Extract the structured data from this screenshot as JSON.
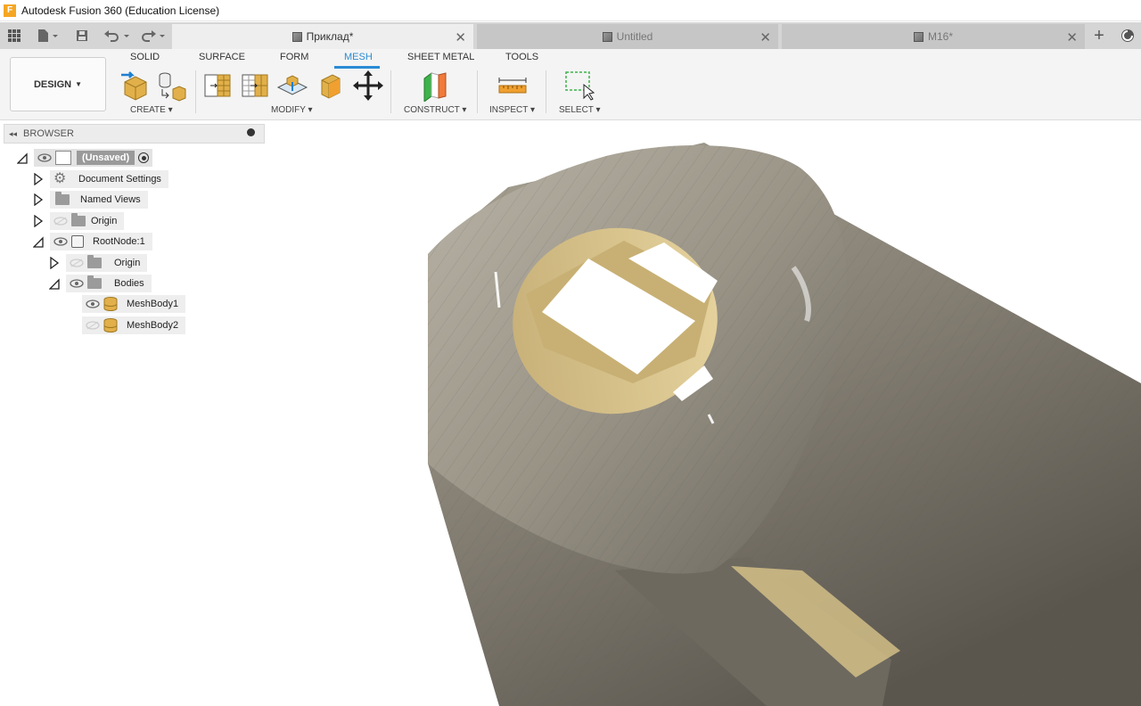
{
  "window": {
    "title": "Autodesk Fusion 360 (Education License)",
    "app_icon": "fusion-logo-icon"
  },
  "tabs": [
    {
      "label": "Приклад*",
      "active": true
    },
    {
      "label": "Untitled",
      "active": false
    },
    {
      "label": "M16*",
      "active": false
    }
  ],
  "ribbon": {
    "workspace": "DESIGN",
    "tabs": [
      "SOLID",
      "SURFACE",
      "FORM",
      "MESH",
      "SHEET METAL",
      "TOOLS"
    ],
    "active_tab": "MESH",
    "groups": [
      "CREATE",
      "MODIFY",
      "CONSTRUCT",
      "INSPECT",
      "SELECT"
    ]
  },
  "browser": {
    "title": "BROWSER",
    "root": "(Unsaved)",
    "items": [
      "Document Settings",
      "Named Views",
      "Origin",
      "RootNode:1",
      "Origin",
      "Bodies",
      "MeshBody1",
      "MeshBody2"
    ]
  },
  "colors": {
    "accent": "#2a8bd5",
    "mesh_body": "#8a8478",
    "mesh_inner": "#d9c48a"
  }
}
